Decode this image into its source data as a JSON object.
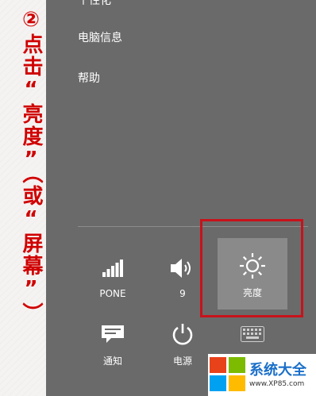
{
  "annotation": {
    "text": "②点击“亮度”（或“屏幕”）"
  },
  "menu": {
    "items": [
      "个性化",
      "电脑信息",
      "帮助"
    ]
  },
  "quick_settings": {
    "network_label": "PONE",
    "volume_label": "9",
    "brightness_label": "亮度",
    "notifications_label": "通知",
    "power_label": "电源",
    "keyboard_label": "键盘"
  },
  "watermark": {
    "name": "系统大全",
    "url": "www.XP85.com"
  },
  "colors": {
    "panel_bg": "#6a6a6a",
    "highlight_border": "#c8121a",
    "annotation_text": "#d00000"
  }
}
